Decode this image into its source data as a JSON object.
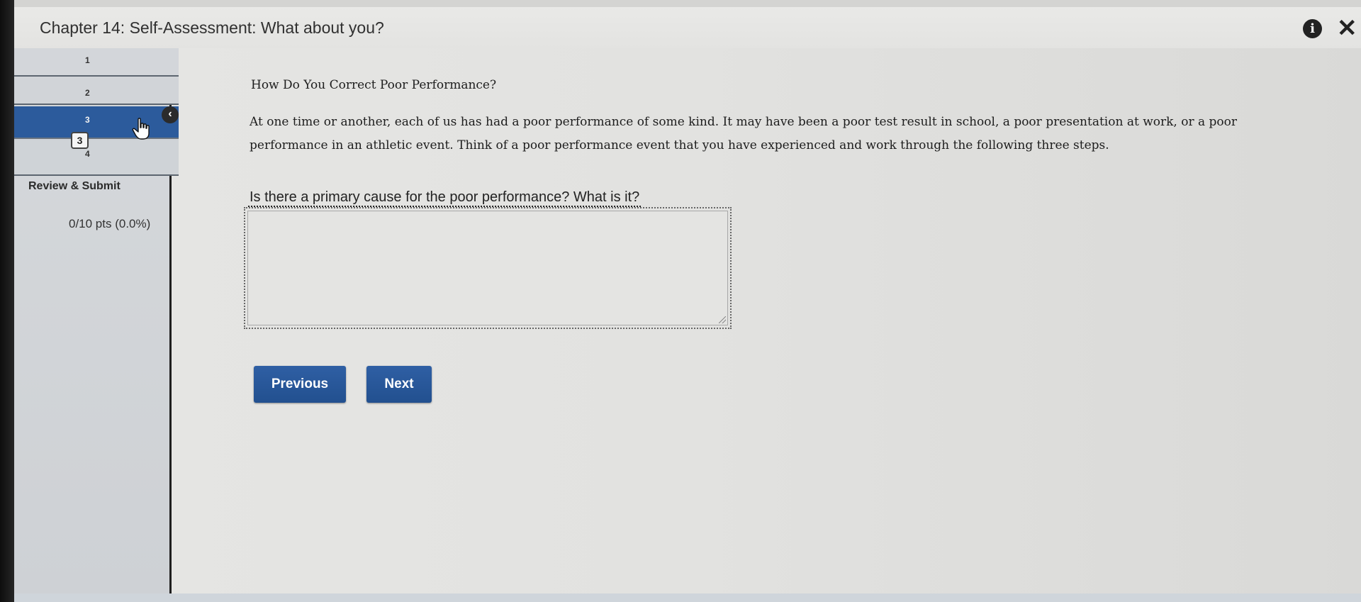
{
  "header": {
    "title": "Chapter 14: Self-Assessment: What about you?",
    "info_icon": "i",
    "close_icon": "✕"
  },
  "sidebar": {
    "steps": [
      {
        "label": "1"
      },
      {
        "label": "2"
      },
      {
        "label": "3",
        "active": true
      },
      {
        "label": "4"
      }
    ],
    "current_badge": "3",
    "collapse_icon": "‹",
    "review_submit": "Review & Submit",
    "score": "0/10 pts (0.0%)"
  },
  "main": {
    "heading": "How Do You Correct Poor Performance?",
    "body": "At one time or another, each of us has had a poor performance of some kind. It may have been a poor test result in school, a poor presentation at work, or a poor performance in an athletic event. Think of a poor performance event that you have experienced and work through the following three steps.",
    "question": "Is there a primary cause for the poor performance? What is it?",
    "answer_value": "",
    "previous_label": "Previous",
    "next_label": "Next"
  },
  "colors": {
    "accent": "#2c5b9c",
    "button": "#2a589b"
  }
}
